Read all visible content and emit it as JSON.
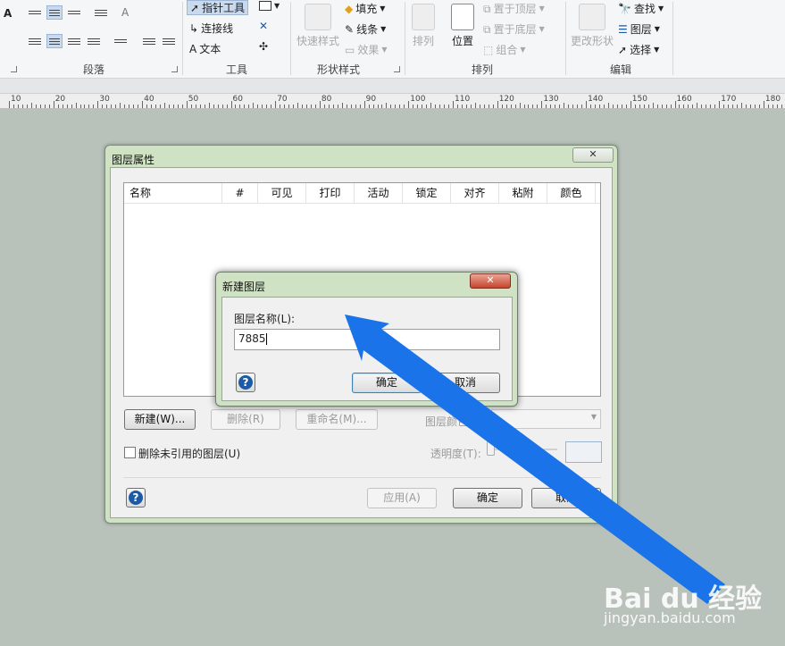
{
  "ribbon": {
    "groups": {
      "paragraph": "段落",
      "tools": "工具",
      "shape_styles": "形状样式",
      "arrange": "排列",
      "edit": "编辑"
    },
    "tools": {
      "pointer": "指针工具",
      "connector": "连接线",
      "text": "文本"
    },
    "shape_styles": {
      "quick_styles": "快速样式",
      "fill": "填充",
      "line": "线条",
      "effects": "效果"
    },
    "arrange": {
      "align": "排列",
      "position": "位置",
      "bring_front": "置于顶层",
      "send_back": "置于底层",
      "group": "组合"
    },
    "edit": {
      "change_shape": "更改形状",
      "find": "查找",
      "layers": "图层",
      "select": "选择"
    },
    "font_letter": "A"
  },
  "ruler": {
    "labels": [
      "10",
      "20",
      "30",
      "40",
      "50",
      "60",
      "70",
      "80",
      "90",
      "100",
      "110",
      "120",
      "130",
      "140",
      "150",
      "160",
      "170",
      "180"
    ]
  },
  "layer_properties": {
    "title": "图层属性",
    "close": "✕",
    "columns": [
      "名称",
      "#",
      "可见",
      "打印",
      "活动",
      "锁定",
      "对齐",
      "粘附",
      "颜色"
    ],
    "new_button": "新建(W)...",
    "delete_button": "删除(R)",
    "rename_button": "重命名(M)...",
    "layer_color_label": "图层颜色(C):",
    "remove_unref_label": "删除未引用的图层(U)",
    "transparency_label": "透明度(T):",
    "apply_button": "应用(A)",
    "ok_button": "确定",
    "cancel_button": "取消"
  },
  "new_layer": {
    "title": "新建图层",
    "close": "✕",
    "name_label": "图层名称(L):",
    "name_value": "7885",
    "ok_button": "确定",
    "cancel_button": "取消"
  },
  "watermark": {
    "brand": "Bai du 经验",
    "url": "jingyan.baidu.com"
  },
  "colors": {
    "arrow": "#1a73e8",
    "dialog_frame": "#cfe2c4",
    "canvas": "#b8c2bb"
  }
}
